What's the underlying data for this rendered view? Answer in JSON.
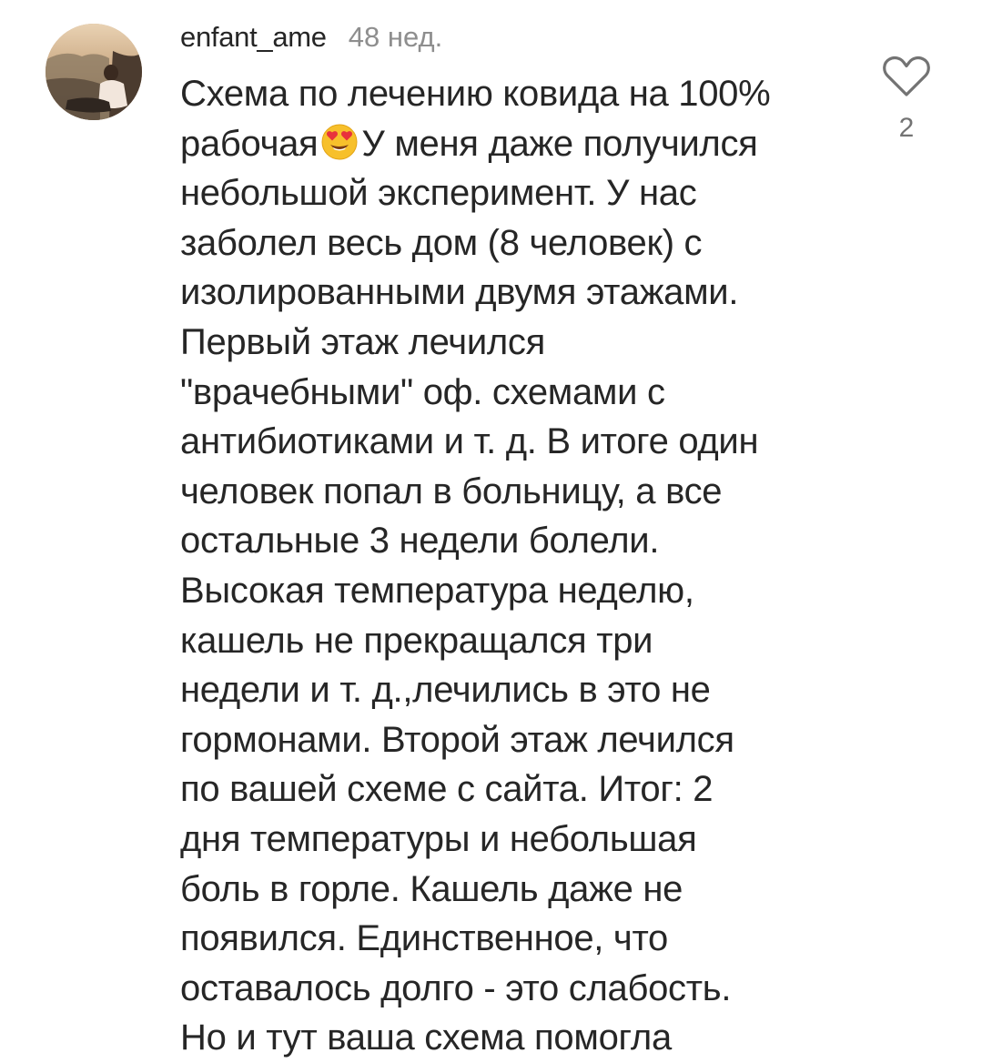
{
  "comment": {
    "username": "enfant_ame",
    "timestamp": "48 нед.",
    "avatar_icon": "user-avatar-photo",
    "like_icon": "heart-outline-icon",
    "like_count": "2",
    "emoji_icon": "heart-eyes-emoji",
    "lines": [
      "Схема по лечению ковида на 100%",
      "рабочая",
      "У меня даже получился",
      "небольшой эксперимент. У нас",
      "заболел весь дом (8 человек) с",
      "изолированными двумя этажами.",
      "Первый этаж лечился",
      "\"врачебными\" оф. схемами с",
      "антибиотиками и т. д. В итоге один",
      "человек попал в больницу, а все",
      "остальные 3 недели болели.",
      "Высокая температура неделю,",
      "кашель не прекращался три",
      "недели и т. д.,лечились в это не",
      "гормонами. Второй этаж лечился",
      "по вашей схеме с сайта. Итог: 2",
      "дня температуры и небольшая",
      "боль в горле. Кашель даже не",
      "появился. Единственное, что",
      "оставалось долго - это слабость.",
      "Но и тут ваша схема помогла"
    ]
  }
}
